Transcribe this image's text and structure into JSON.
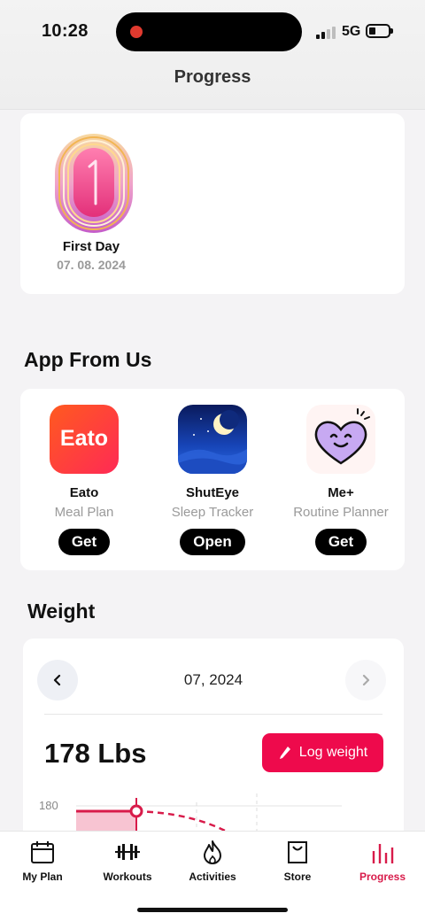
{
  "status_bar": {
    "time": "10:28",
    "network": "5G"
  },
  "header": {
    "title": "Progress"
  },
  "achievement": {
    "badge_number": "1",
    "title": "First Day",
    "date": "07. 08. 2024"
  },
  "apps_section": {
    "title": "App From Us",
    "apps": [
      {
        "name": "Eato",
        "subtitle": "Meal Plan",
        "button": "Get",
        "icon_text": "Eato",
        "icon": "eato-app-icon"
      },
      {
        "name": "ShutEye",
        "subtitle": "Sleep Tracker",
        "button": "Open",
        "icon": "shuteye-moon-icon"
      },
      {
        "name": "Me+",
        "subtitle": "Routine Planner",
        "button": "Get",
        "icon": "smiling-heart-icon"
      }
    ]
  },
  "weight": {
    "title": "Weight",
    "period": "07, 2024",
    "value": "178 Lbs",
    "log_button": "Log weight",
    "y_tick": "180"
  },
  "tabs": [
    {
      "label": "My Plan",
      "icon": "calendar-icon"
    },
    {
      "label": "Workouts",
      "icon": "dumbbell-icon"
    },
    {
      "label": "Activities",
      "icon": "flame-icon"
    },
    {
      "label": "Store",
      "icon": "shopping-bag-icon"
    },
    {
      "label": "Progress",
      "icon": "bar-chart-icon",
      "active": true
    }
  ],
  "colors": {
    "accent": "#ee0a4c",
    "tab_active": "#d81b4a"
  }
}
